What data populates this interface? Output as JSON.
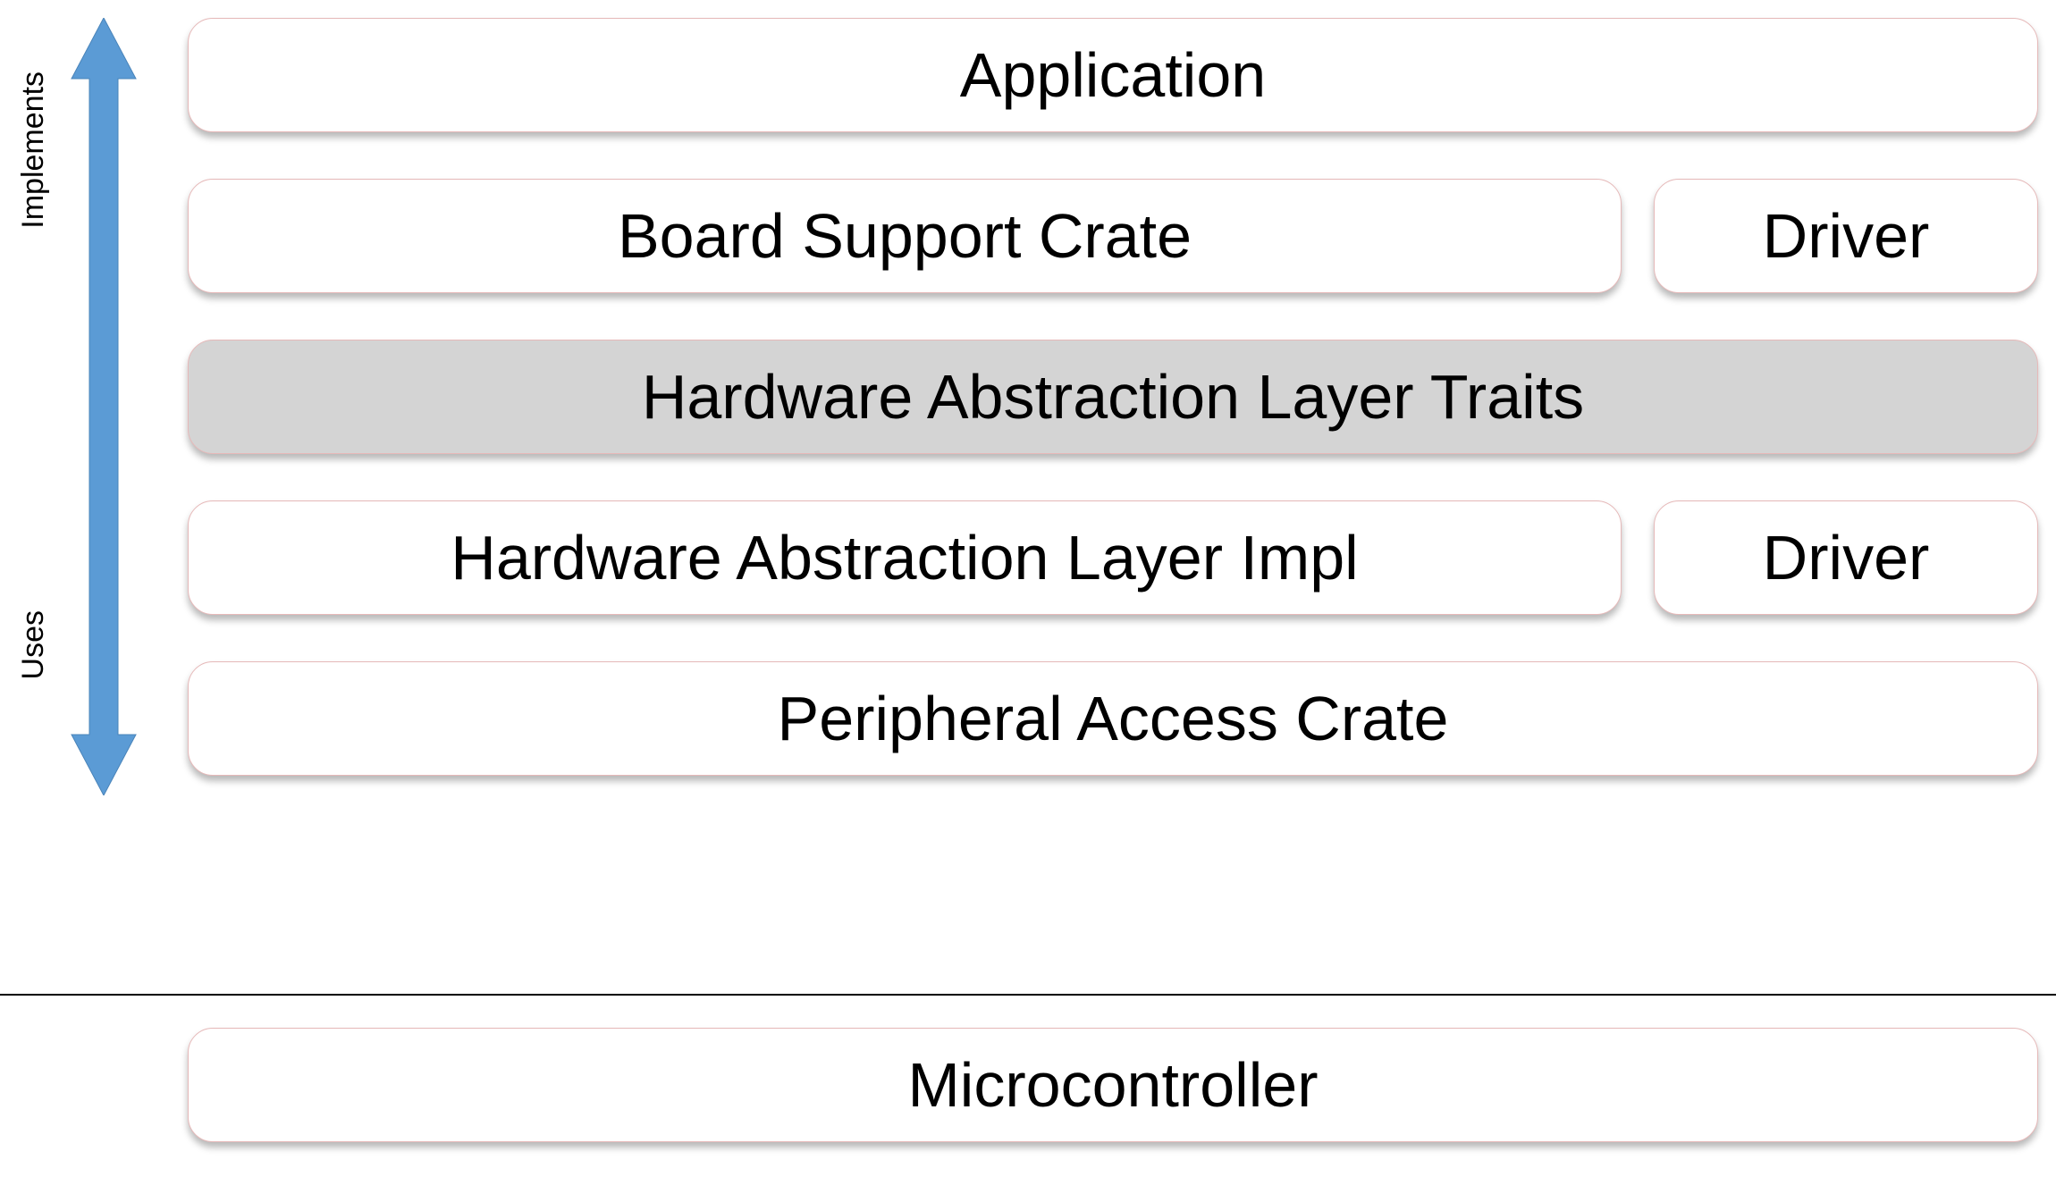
{
  "arrow": {
    "label_top": "Implements",
    "label_bottom": "Uses",
    "color": "#5b9bd5"
  },
  "layers": {
    "application": "Application",
    "bsc": "Board Support Crate",
    "driver_top": "Driver",
    "hal_traits": "Hardware Abstraction Layer Traits",
    "hal_impl": "Hardware Abstraction Layer Impl",
    "driver_bottom": "Driver",
    "pac": "Peripheral Access Crate",
    "microcontroller": "Microcontroller"
  }
}
